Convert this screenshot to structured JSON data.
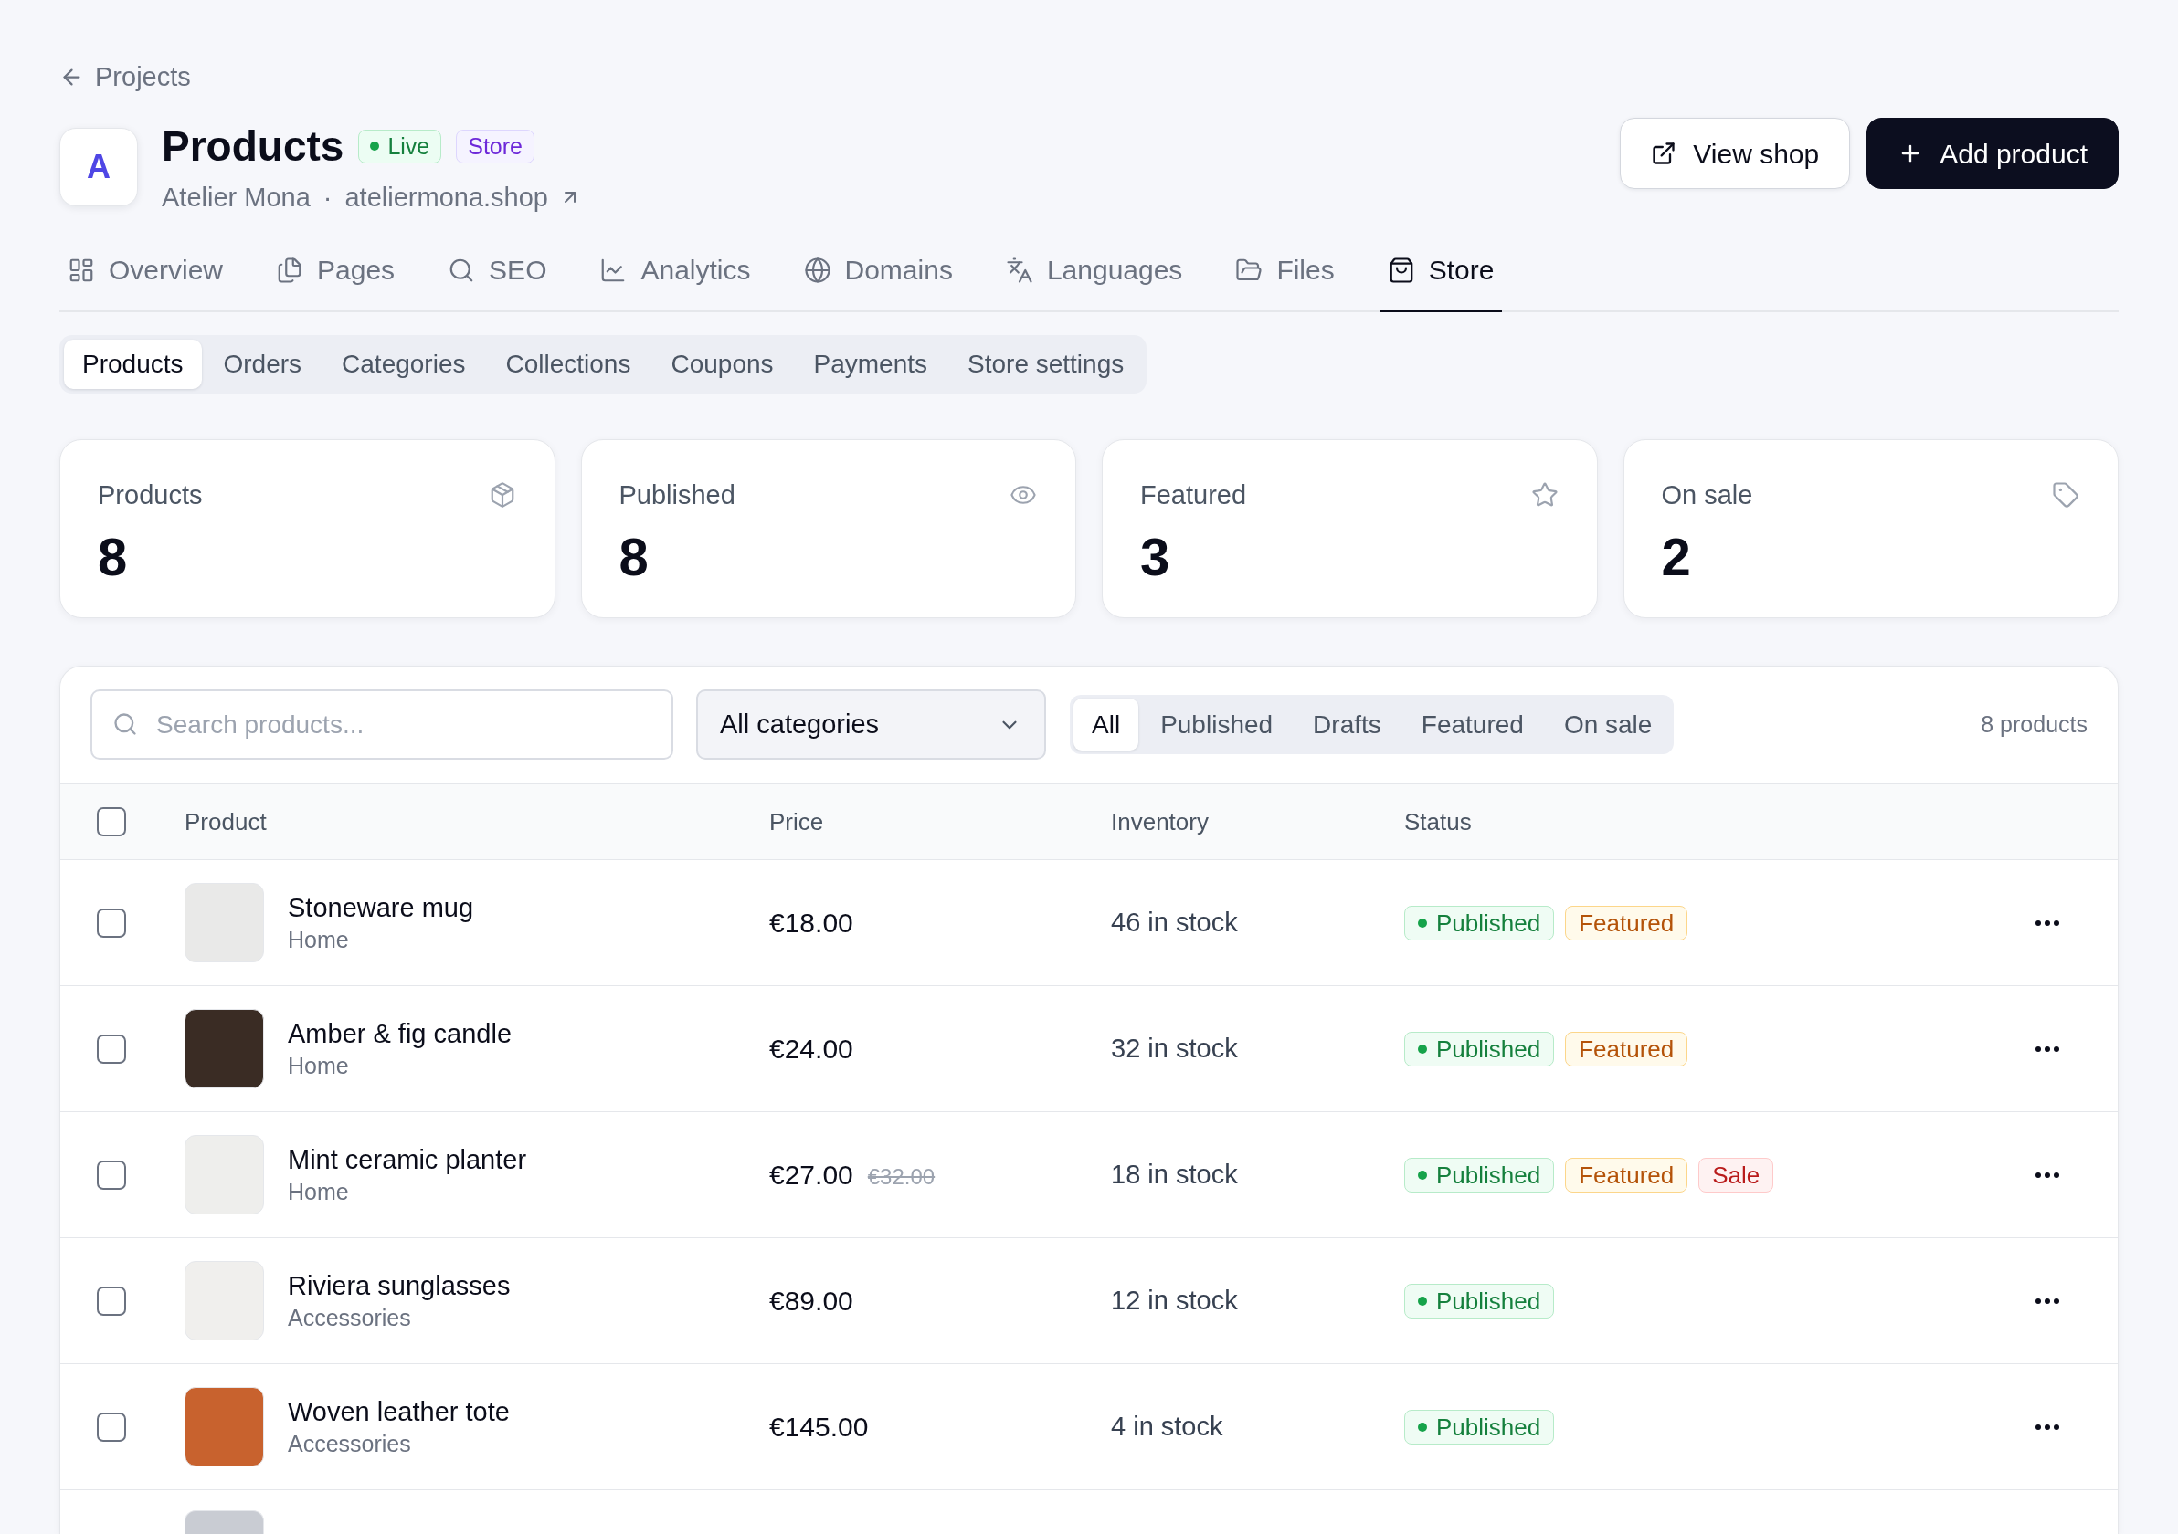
{
  "back_link": {
    "label": "Projects"
  },
  "header": {
    "avatar": "A",
    "title": "Products",
    "badges": [
      {
        "kind": "live",
        "label": "Live"
      },
      {
        "kind": "label",
        "label": "Store"
      }
    ],
    "owner": "Atelier Mona",
    "separator": "·",
    "domain": "ateliermona.shop"
  },
  "actions": [
    {
      "kind": "secondary",
      "label": "View shop"
    },
    {
      "kind": "primary",
      "label": "Add product"
    }
  ],
  "nav_tabs": [
    {
      "label": "Overview",
      "selected": false
    },
    {
      "label": "Pages",
      "selected": false
    },
    {
      "label": "SEO",
      "selected": false
    },
    {
      "label": "Analytics",
      "selected": false
    },
    {
      "label": "Domains",
      "selected": false
    },
    {
      "label": "Languages",
      "selected": false
    },
    {
      "label": "Files",
      "selected": false
    },
    {
      "label": "Store",
      "selected": true
    }
  ],
  "sub_tabs": [
    {
      "label": "Products",
      "selected": true
    },
    {
      "label": "Orders",
      "selected": false
    },
    {
      "label": "Categories",
      "selected": false
    },
    {
      "label": "Collections",
      "selected": false
    },
    {
      "label": "Coupons",
      "selected": false
    },
    {
      "label": "Payments",
      "selected": false
    },
    {
      "label": "Store settings",
      "selected": false
    }
  ],
  "stats": [
    {
      "label": "Products",
      "value": "8"
    },
    {
      "label": "Published",
      "value": "8"
    },
    {
      "label": "Featured",
      "value": "3"
    },
    {
      "label": "On sale",
      "value": "2"
    }
  ],
  "filters": {
    "search": {
      "placeholder": "Search products..."
    },
    "category": {
      "value": "All categories"
    },
    "status_tabs": [
      {
        "label": "All",
        "selected": true
      },
      {
        "label": "Published",
        "selected": false
      },
      {
        "label": "Drafts",
        "selected": false
      },
      {
        "label": "Featured",
        "selected": false
      },
      {
        "label": "On sale",
        "selected": false
      }
    ],
    "count": "8 products"
  },
  "table": {
    "select_all": {
      "checked": false
    },
    "columns": [
      "Product",
      "Price",
      "Inventory",
      "Status"
    ],
    "rows": [
      {
        "checked": false,
        "name": "Stoneware mug",
        "category": "Home",
        "price": "€18.00",
        "inventory": "46 in stock",
        "badges": [
          {
            "kind": "published",
            "label": "Published"
          },
          {
            "kind": "featured",
            "label": "Featured"
          }
        ]
      },
      {
        "checked": false,
        "name": "Amber & fig candle",
        "category": "Home",
        "price": "€24.00",
        "inventory": "32 in stock",
        "badges": [
          {
            "kind": "published",
            "label": "Published"
          },
          {
            "kind": "featured",
            "label": "Featured"
          }
        ]
      },
      {
        "checked": false,
        "name": "Mint ceramic planter",
        "category": "Home",
        "price": "€27.00",
        "original_price": "€32.00",
        "inventory": "18 in stock",
        "badges": [
          {
            "kind": "published",
            "label": "Published"
          },
          {
            "kind": "featured",
            "label": "Featured"
          },
          {
            "kind": "sale",
            "label": "Sale"
          }
        ]
      },
      {
        "checked": false,
        "name": "Riviera sunglasses",
        "category": "Accessories",
        "price": "€89.00",
        "inventory": "12 in stock",
        "badges": [
          {
            "kind": "published",
            "label": "Published"
          }
        ]
      },
      {
        "checked": false,
        "name": "Woven leather tote",
        "category": "Accessories",
        "price": "€145.00",
        "inventory": "4 in stock",
        "badges": [
          {
            "kind": "published",
            "label": "Published"
          }
        ]
      }
    ]
  }
}
